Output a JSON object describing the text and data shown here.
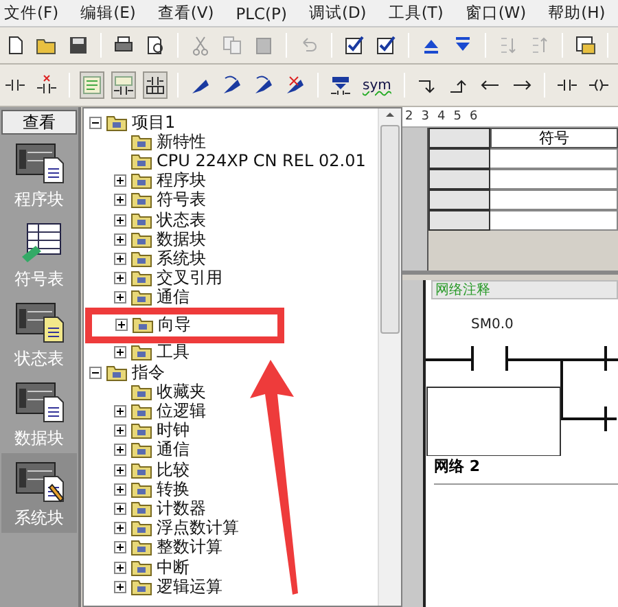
{
  "menu": [
    "文件(F)",
    "编辑(E)",
    "查看(V)",
    "PLC(P)",
    "调试(D)",
    "工具(T)",
    "窗口(W)",
    "帮助(H)"
  ],
  "toolbar_2": {
    "symbol_button": "sym"
  },
  "view_panel": {
    "title": "查看",
    "items": [
      {
        "label": "程序块",
        "selected": false
      },
      {
        "label": "符号表",
        "selected": false
      },
      {
        "label": "状态表",
        "selected": false
      },
      {
        "label": "数据块",
        "selected": false
      },
      {
        "label": "系统块",
        "selected": true
      }
    ]
  },
  "tree": [
    {
      "label": "项目1",
      "expanded": true,
      "children": [
        {
          "label": "新特性"
        },
        {
          "label": "CPU 224XP CN REL 02.01"
        },
        {
          "label": "程序块",
          "expanded": false
        },
        {
          "label": "符号表",
          "expanded": false
        },
        {
          "label": "状态表",
          "expanded": false
        },
        {
          "label": "数据块",
          "expanded": false
        },
        {
          "label": "系统块",
          "expanded": false
        },
        {
          "label": "交叉引用",
          "expanded": false
        },
        {
          "label": "通信",
          "expanded": false
        },
        {
          "label": "向导",
          "expanded": false,
          "highlighted": true
        },
        {
          "label": "工具",
          "expanded": false
        }
      ]
    },
    {
      "label": "指令",
      "expanded": true,
      "children": [
        {
          "label": "收藏夹"
        },
        {
          "label": "位逻辑",
          "expanded": false
        },
        {
          "label": "时钟",
          "expanded": false
        },
        {
          "label": "通信",
          "expanded": false
        },
        {
          "label": "比较",
          "expanded": false
        },
        {
          "label": "转换",
          "expanded": false
        },
        {
          "label": "计数器",
          "expanded": false
        },
        {
          "label": "浮点数计算",
          "expanded": false
        },
        {
          "label": "整数计算",
          "expanded": false
        },
        {
          "label": "中断",
          "expanded": false
        },
        {
          "label": "逻辑运算",
          "expanded": false
        }
      ]
    }
  ],
  "editor": {
    "ruler": [
      "2",
      "3",
      "4",
      "5",
      "6"
    ],
    "symbol_table": {
      "columns": [
        "符号"
      ],
      "row_count_rows": [
        {},
        {},
        {},
        {}
      ]
    },
    "network_comment": "网络注释",
    "contact_label": "SM0.0",
    "network_2": "网络 2"
  }
}
